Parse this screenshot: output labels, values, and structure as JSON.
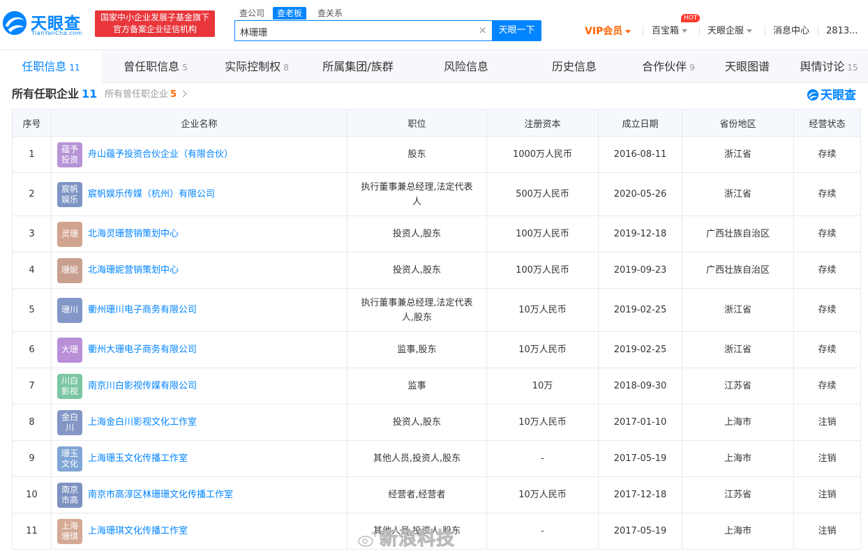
{
  "header": {
    "logo_text": "天眼查",
    "logo_sub": "TianYanCha.com",
    "promo_line1": "国家中小企业发展子基金旗下",
    "promo_line2": "官方备案企业征信机构",
    "search_tabs": [
      "查公司",
      "查老板",
      "查关系"
    ],
    "search_value": "林珊珊",
    "search_button": "天眼一下",
    "nav": {
      "vip": "VIP会员",
      "baibaoxiang": "百宝箱",
      "hot_badge": "HOT",
      "qiye": "天眼企服",
      "message": "消息中心",
      "user": "2813..."
    }
  },
  "section_tabs": [
    {
      "label": "任职信息",
      "count": "11"
    },
    {
      "label": "曾任职信息",
      "count": "5"
    },
    {
      "label": "实际控制权",
      "count": "8"
    },
    {
      "label": "所属集团/族群",
      "count": ""
    },
    {
      "label": "风险信息",
      "count": ""
    },
    {
      "label": "历史信息",
      "count": ""
    },
    {
      "label": "合作伙伴",
      "count": "9"
    },
    {
      "label": "天眼图谱",
      "count": ""
    },
    {
      "label": "舆情讨论",
      "count": "15"
    }
  ],
  "content": {
    "title": "所有任职企业",
    "title_count": "11",
    "sub_link": "所有曾任职企业",
    "sub_link_count": "5",
    "brand": "天眼查"
  },
  "table": {
    "headers": [
      "序号",
      "企业名称",
      "职位",
      "注册资本",
      "成立日期",
      "省份地区",
      "经营状态"
    ],
    "rows": [
      {
        "no": "1",
        "logo": "蕴予投资",
        "logo_color": "#b794d6",
        "name": "舟山蕴予投资合伙企业（有限合伙）",
        "position": "股东",
        "capital": "1000万人民币",
        "date": "2016-08-11",
        "region": "浙江省",
        "status": "存续"
      },
      {
        "no": "2",
        "logo": "宸帆娱乐",
        "logo_color": "#7d95c4",
        "name": "宸帆娱乐传媒（杭州）有限公司",
        "position": "执行董事兼总经理,法定代表人",
        "capital": "500万人民币",
        "date": "2020-05-26",
        "region": "浙江省",
        "status": "存续"
      },
      {
        "no": "3",
        "logo": "灵珊",
        "logo_color": "#d1a48f",
        "name": "北海灵珊营销策划中心",
        "position": "投资人,股东",
        "capital": "100万人民币",
        "date": "2019-12-18",
        "region": "广西壮族自治区",
        "status": "存续"
      },
      {
        "no": "4",
        "logo": "珊妮",
        "logo_color": "#c9a08f",
        "name": "北海珊妮营销策划中心",
        "position": "投资人,股东",
        "capital": "100万人民币",
        "date": "2019-09-23",
        "region": "广西壮族自治区",
        "status": "存续"
      },
      {
        "no": "5",
        "logo": "珊川",
        "logo_color": "#8297c7",
        "name": "衢州珊川电子商务有限公司",
        "position": "执行董事兼总经理,法定代表人,股东",
        "capital": "10万人民币",
        "date": "2019-02-25",
        "region": "浙江省",
        "status": "存续"
      },
      {
        "no": "6",
        "logo": "大珊",
        "logo_color": "#b98fd8",
        "name": "衢州大珊电子商务有限公司",
        "position": "监事,股东",
        "capital": "10万人民币",
        "date": "2019-02-25",
        "region": "浙江省",
        "status": "存续"
      },
      {
        "no": "7",
        "logo": "川白影视",
        "logo_color": "#7cc6a4",
        "name": "南京川白影视传媒有限公司",
        "position": "监事",
        "capital": "10万",
        "date": "2018-09-30",
        "region": "江苏省",
        "status": "存续"
      },
      {
        "no": "8",
        "logo": "金白川",
        "logo_color": "#8396c6",
        "name": "上海金白川影视文化工作室",
        "position": "投资人,股东",
        "capital": "10万人民币",
        "date": "2017-01-10",
        "region": "上海市",
        "status": "注销"
      },
      {
        "no": "9",
        "logo": "珊玉文化",
        "logo_color": "#80a6d6",
        "name": "上海珊玉文化传播工作室",
        "position": "其他人员,投资人,股东",
        "capital": "-",
        "date": "2017-05-19",
        "region": "上海市",
        "status": "注销"
      },
      {
        "no": "10",
        "logo": "南京市高",
        "logo_color": "#7e92c2",
        "name": "南京市高淳区林珊珊文化传播工作室",
        "position": "经营者,经营者",
        "capital": "10万人民币",
        "date": "2017-12-18",
        "region": "江苏省",
        "status": "注销"
      },
      {
        "no": "11",
        "logo": "上海珊琪",
        "logo_color": "#d4a995",
        "name": "上海珊琪文化传播工作室",
        "position": "其他人员,投资人,股东",
        "capital": "-",
        "date": "2017-05-19",
        "region": "上海市",
        "status": "注销"
      }
    ]
  },
  "watermark": "新浪科技",
  "colors": {
    "brand_blue": "#0084ff",
    "promo_red": "#e8363b",
    "vip_orange": "#ff6600",
    "status_active": "#23a650",
    "status_cancel": "#e33e33"
  }
}
